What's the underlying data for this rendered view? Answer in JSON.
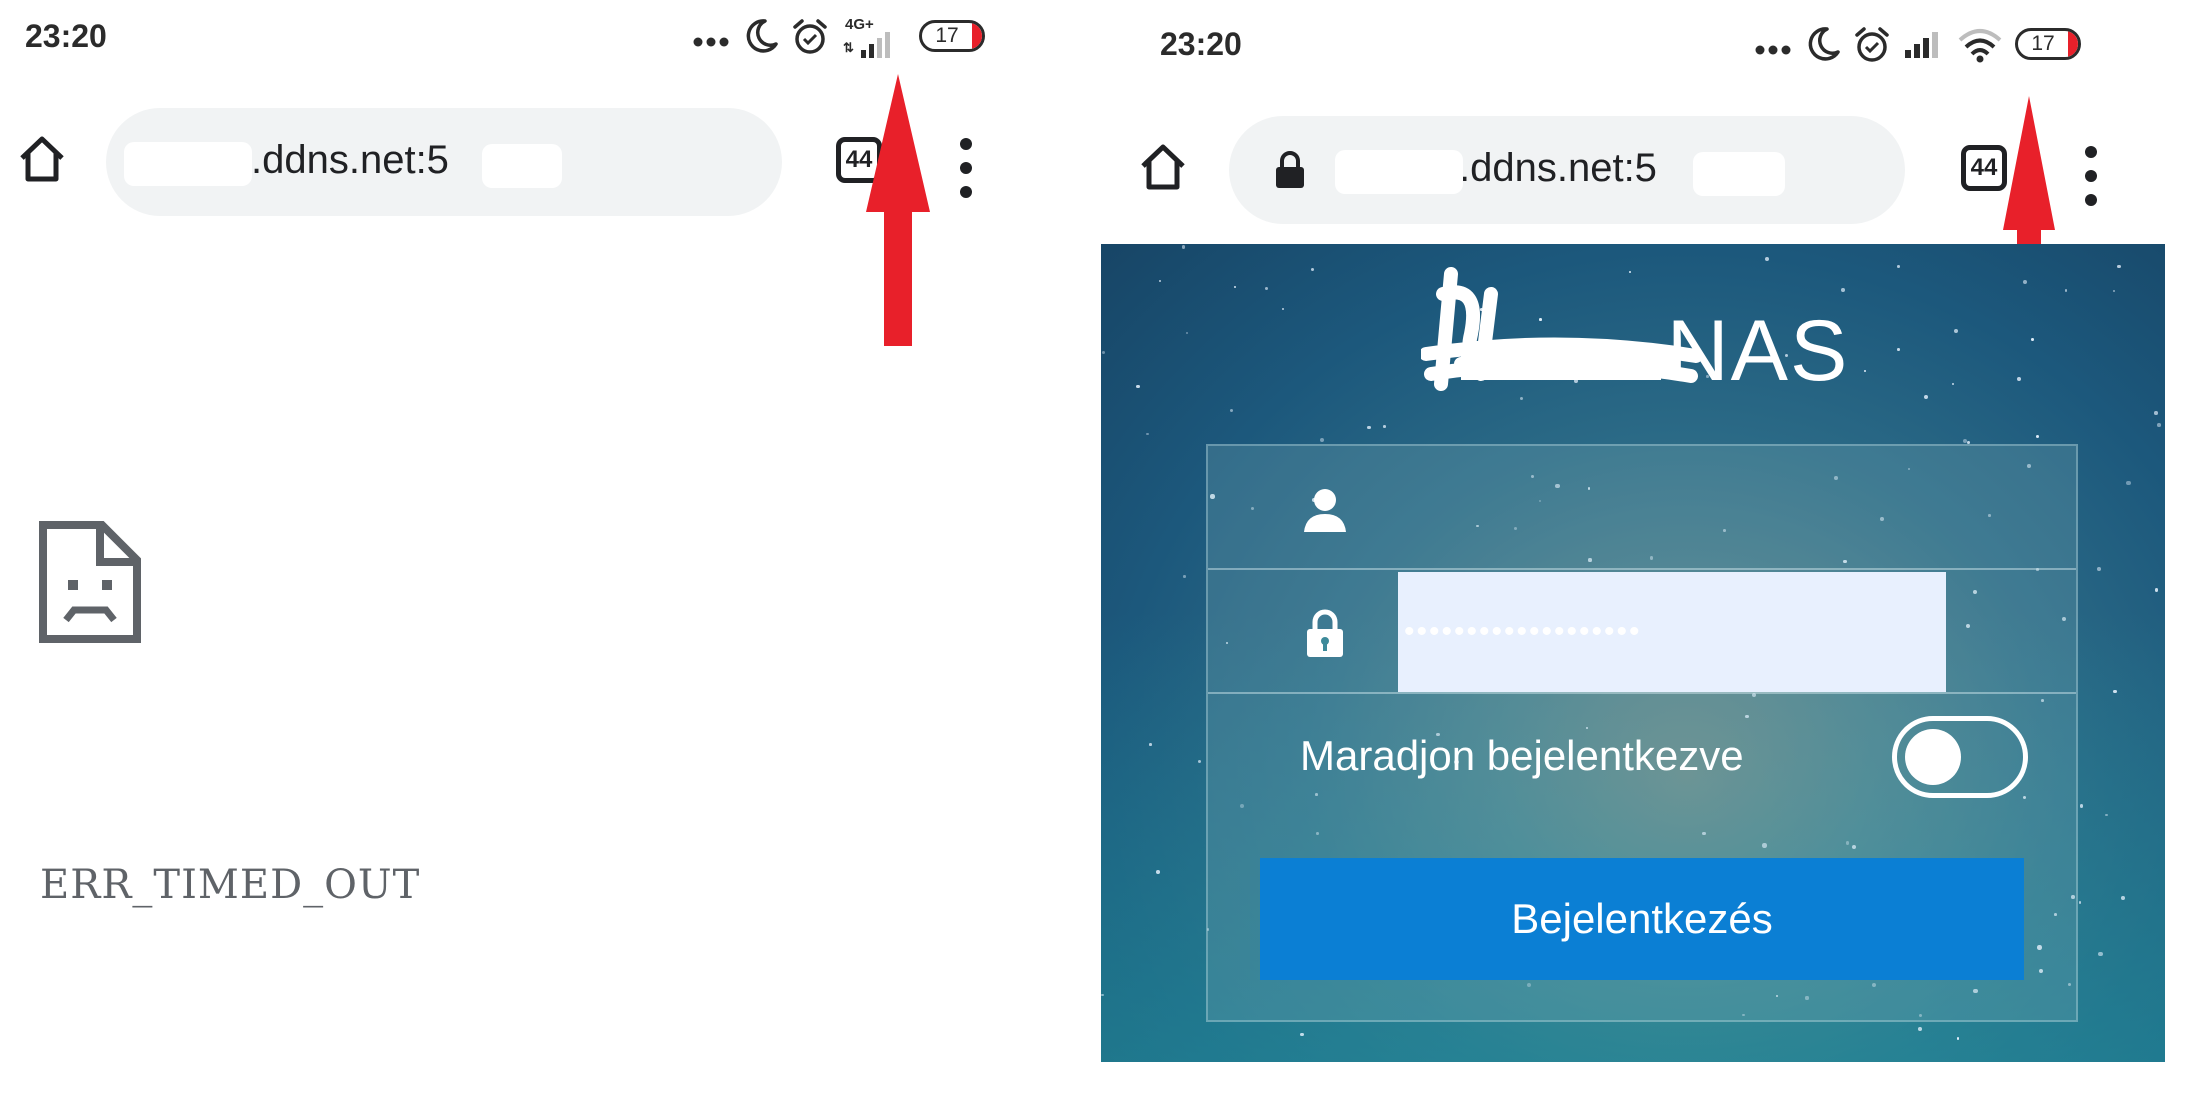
{
  "left_screen": {
    "status_bar": {
      "time": "23:20",
      "network_label": "4G+",
      "battery_level": "17",
      "icons": [
        "more-dots-icon",
        "moon-icon",
        "alarm-icon",
        "cellular-signal-icon",
        "battery-icon"
      ]
    },
    "browser": {
      "url_visible": ".ddns.net:5",
      "tab_count": "44",
      "home_icon": "home-icon",
      "menu_icon": "more-vert-icon"
    },
    "error_page": {
      "icon": "sad-document-icon",
      "error_code": "ERR_TIMED_OUT"
    },
    "annotation": {
      "arrow_color": "#e8202a"
    }
  },
  "right_screen": {
    "status_bar": {
      "time": "23:20",
      "battery_level": "17",
      "icons": [
        "more-dots-icon",
        "moon-icon",
        "alarm-icon",
        "cellular-signal-icon",
        "wifi-icon",
        "battery-icon"
      ]
    },
    "browser": {
      "url_visible": ".ddns.net:5",
      "tab_count": "44",
      "home_icon": "home-icon",
      "lock_icon": "lock-icon",
      "menu_icon": "more-vert-icon"
    },
    "nas_login": {
      "title_suffix": "NAS",
      "username_icon": "user-icon",
      "password_icon": "padlock-icon",
      "password_mask": "•••••••••••••••••••",
      "remember_label": "Maradjon bejelentkezve",
      "remember_checked": false,
      "login_button": "Bejelentkezés",
      "button_color": "#0b7fd4"
    },
    "annotation": {
      "arrow_color": "#e8202a"
    }
  }
}
